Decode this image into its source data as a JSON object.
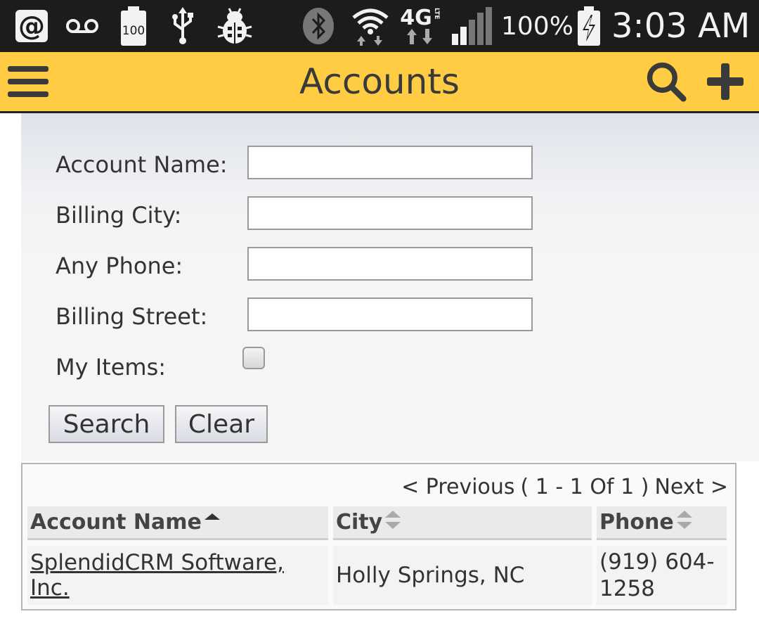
{
  "status_bar": {
    "battery_badge": "100",
    "network": "4G",
    "network_sub": "LTE",
    "battery_percent": "100%",
    "time": "3:03 AM",
    "icons": [
      "at-icon",
      "voicemail-icon",
      "battery-100-icon",
      "usb-icon",
      "debug-bug-icon",
      "bluetooth-icon",
      "wifi-icon",
      "lte-icon",
      "signal-icon",
      "battery-charging-icon"
    ]
  },
  "app_bar": {
    "title": "Accounts",
    "icons": [
      "menu-icon",
      "search-icon",
      "add-icon"
    ],
    "background": "#ffcc44"
  },
  "search_form": {
    "fields": [
      {
        "label": "Account Name:",
        "value": "",
        "placeholder": ""
      },
      {
        "label": "Billing City:",
        "value": "",
        "placeholder": ""
      },
      {
        "label": "Any Phone:",
        "value": "",
        "placeholder": ""
      },
      {
        "label": "Billing Street:",
        "value": "",
        "placeholder": ""
      }
    ],
    "my_items_label": "My Items:",
    "my_items_checked": false,
    "search_button": "Search",
    "clear_button": "Clear"
  },
  "results": {
    "pager": {
      "previous": "< Previous",
      "range": "( 1 - 1 Of 1 )",
      "next": "Next >"
    },
    "columns": [
      "Account Name",
      "City",
      "Phone"
    ],
    "sort": {
      "column": "Account Name",
      "direction": "ascending"
    },
    "rows": [
      {
        "account_name": "SplendidCRM Software, Inc.",
        "city": "Holly Springs, NC",
        "phone_line1": "(919) 604-",
        "phone_line2": "1258"
      }
    ]
  }
}
